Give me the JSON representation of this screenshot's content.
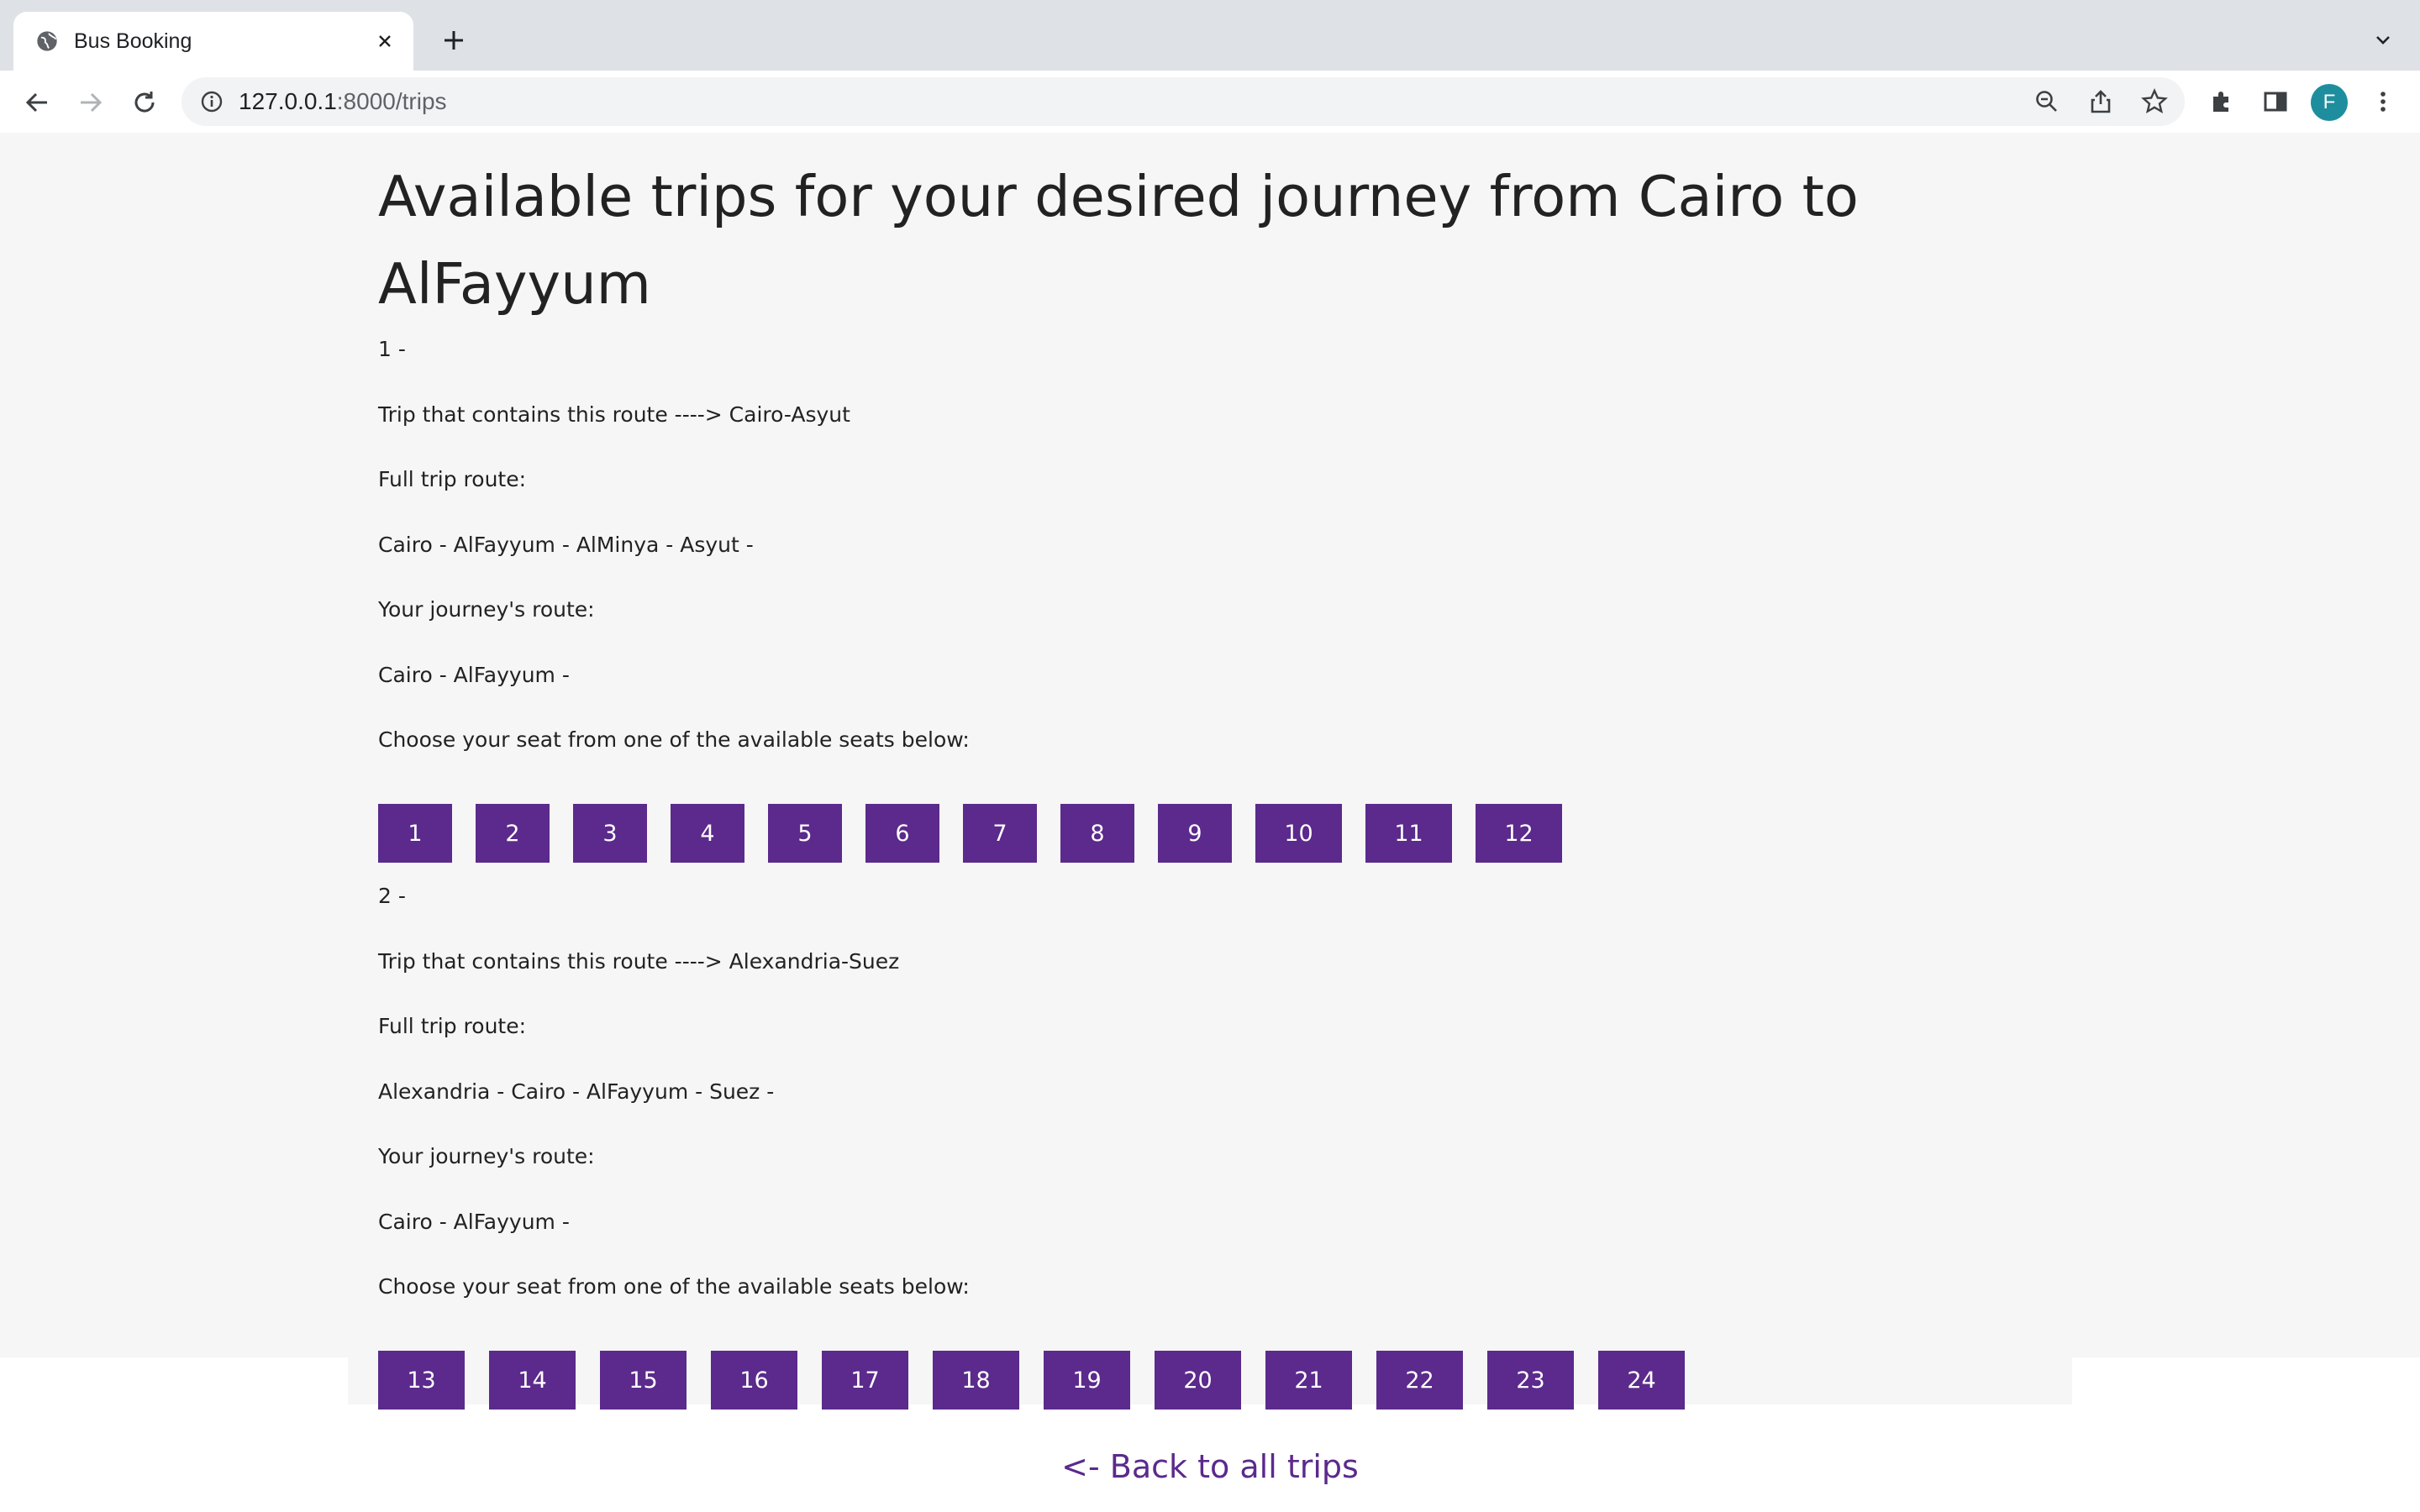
{
  "browser": {
    "tab_title": "Bus Booking",
    "url_host": "127.0.0.1",
    "url_rest": ":8000/trips",
    "avatar_letter": "F"
  },
  "page": {
    "title": "Available trips for your desired journey from Cairo to AlFayyum",
    "back_link": "<- Back to all trips",
    "accent_color": "#5b2a8c"
  },
  "trips": [
    {
      "index_label": "1 -",
      "contains_route": "Trip that contains this route ----> Cairo-Asyut",
      "full_route_label": "Full trip route:",
      "full_route": "Cairo - AlFayyum - AlMinya - Asyut -",
      "journey_route_label": "Your journey's route:",
      "journey_route": "Cairo - AlFayyum -",
      "choose_seat": "Choose your seat from one of the available seats below:",
      "seats": [
        "1",
        "2",
        "3",
        "4",
        "5",
        "6",
        "7",
        "8",
        "9",
        "10",
        "11",
        "12"
      ]
    },
    {
      "index_label": "2 -",
      "contains_route": "Trip that contains this route ----> Alexandria-Suez",
      "full_route_label": "Full trip route:",
      "full_route": "Alexandria - Cairo - AlFayyum - Suez -",
      "journey_route_label": "Your journey's route:",
      "journey_route": "Cairo - AlFayyum -",
      "choose_seat": "Choose your seat from one of the available seats below:",
      "seats": [
        "13",
        "14",
        "15",
        "16",
        "17",
        "18",
        "19",
        "20",
        "21",
        "22",
        "23",
        "24"
      ]
    }
  ]
}
